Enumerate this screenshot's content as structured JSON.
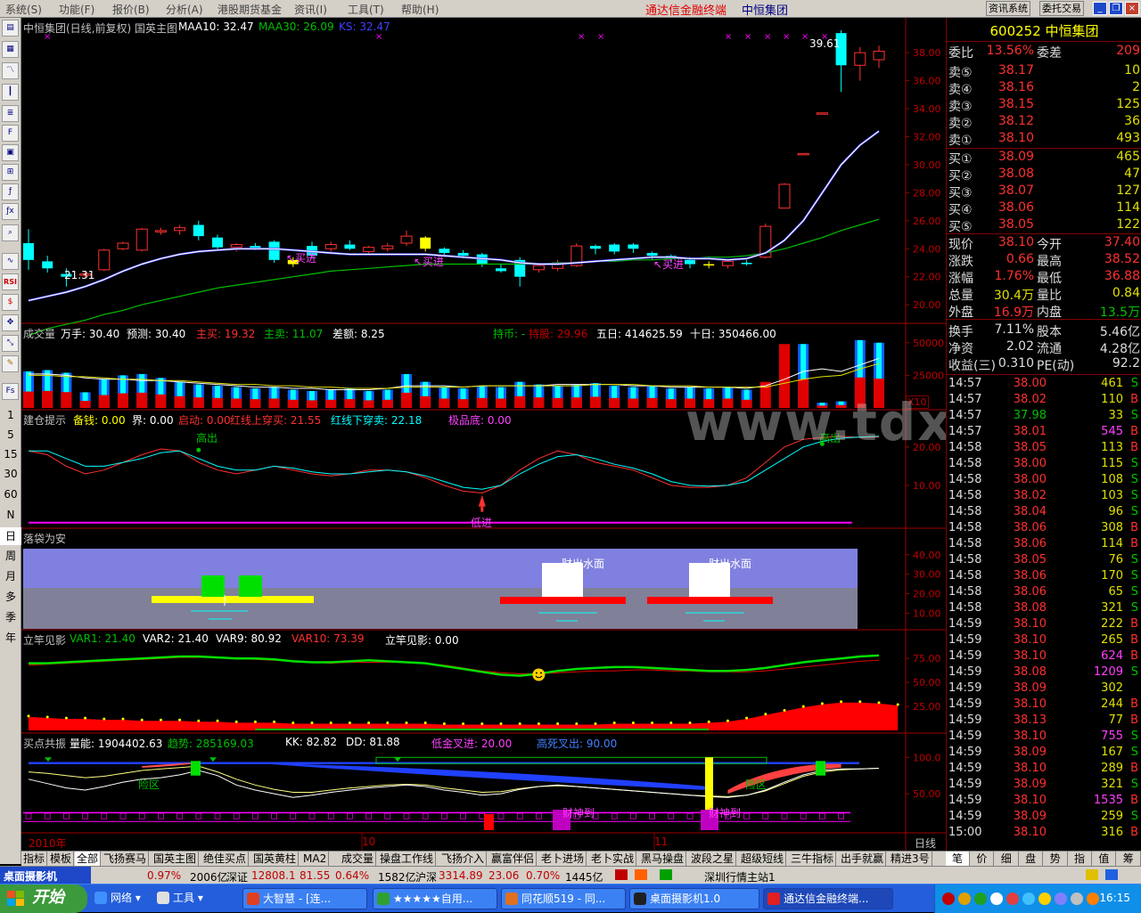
{
  "menu": {
    "items": [
      "系统(S)",
      "功能(F)",
      "报价(B)",
      "分析(A)",
      "港股期货基金",
      "资讯(I)",
      "工具(T)",
      "帮助(H)"
    ],
    "brand": "通达信金融终端",
    "stock_title": "中恒集团",
    "btn_news": "资讯系统",
    "btn_trade": "委托交易"
  },
  "left_tools": [
    "RSI",
    "$",
    "Fs"
  ],
  "periods": [
    "1",
    "5",
    "15",
    "30",
    "60",
    "N",
    "日",
    "周",
    "月",
    "多",
    "季",
    "年"
  ],
  "chart": {
    "main": {
      "header": "中恒集团(日线,前复权) 国英主图",
      "ma10": "MAA10: 32.47",
      "ma30": "MAA30: 26.09",
      "ks": "KS: 32.47",
      "high_label": "39.61",
      "low_label": "21.31",
      "buy_labels": [
        "↖买进",
        "↖买进",
        "↖买进"
      ],
      "yticks": [
        "38.00",
        "36.00",
        "34.00",
        "32.00",
        "30.00",
        "28.00",
        "26.00",
        "24.00",
        "22.00",
        "20.00"
      ]
    },
    "volume": {
      "title": "成交量",
      "wanshou": "万手: 30.40",
      "yuce": "预测: 30.40",
      "zhumai": "主买: 19.32",
      "zhumai2": "主卖: 11.07",
      "chae": "差额: 8.25",
      "chibi": "持币: -",
      "chigu": "持股: 29.96",
      "wuri": "五日: 414625.59",
      "shiri": "十日: 350466.00",
      "yticks": [
        "50000",
        "25000"
      ],
      "unit": "X10"
    },
    "jiancang": {
      "title": "建仓提示",
      "beiqian": "备钱: 0.00",
      "jie": "界: 0.00",
      "qidong": "启动: 0.00",
      "hongshang": "红线上穿买: 21.55",
      "hongxia": "红线下穿卖: 22.18",
      "jipindi": "极品底: 0.00",
      "gaochu": "高出",
      "dijin": "低进",
      "yticks": [
        "20.00",
        "10.00"
      ]
    },
    "luodai": {
      "title": "落袋为安",
      "caichu": "财出水面",
      "yticks": [
        "40.00",
        "30.00",
        "20.00",
        "10.00"
      ]
    },
    "ligan": {
      "title": "立竿见影",
      "var1": "VAR1: 21.40",
      "var2": "VAR2: 21.40",
      "var9": "VAR9: 80.92",
      "var10": "VAR10: 73.39",
      "lgjy": "立竿见影: 0.00",
      "yticks": [
        "75.00",
        "50.00",
        "25.00"
      ]
    },
    "maidian": {
      "title": "买点共振",
      "liangneng": "量能: 1904402.63",
      "qushi": "趋势: 285169.03",
      "kk": "KK: 82.82",
      "dd": "DD: 81.88",
      "dijin": "低金叉进: 20.00",
      "gaosi": "高死叉出: 90.00",
      "xianqu": "险区",
      "caishen": "财神到",
      "yticks": [
        "100.0",
        "50.00"
      ]
    },
    "xaxis": {
      "year": "2010年",
      "m10": "10",
      "m11": "11",
      "period": "日线"
    },
    "watermark": "www.tdxzb.com"
  },
  "quote": {
    "code_name": "600252 中恒集团",
    "weibi_label": "委比",
    "weibi": "13.56%",
    "weicha_label": "委差",
    "weicha": "209",
    "asks": [
      {
        "label": "卖⑤",
        "price": "38.17",
        "vol": "10"
      },
      {
        "label": "卖④",
        "price": "38.16",
        "vol": "2"
      },
      {
        "label": "卖③",
        "price": "38.15",
        "vol": "125"
      },
      {
        "label": "卖②",
        "price": "38.12",
        "vol": "36"
      },
      {
        "label": "卖①",
        "price": "38.10",
        "vol": "493"
      }
    ],
    "bids": [
      {
        "label": "买①",
        "price": "38.09",
        "vol": "465"
      },
      {
        "label": "买②",
        "price": "38.08",
        "vol": "47"
      },
      {
        "label": "买③",
        "price": "38.07",
        "vol": "127"
      },
      {
        "label": "买④",
        "price": "38.06",
        "vol": "114"
      },
      {
        "label": "买⑤",
        "price": "38.05",
        "vol": "122"
      }
    ],
    "stats": [
      {
        "l1": "现价",
        "v1": "38.10",
        "l2": "今开",
        "v2": "37.40"
      },
      {
        "l1": "涨跌",
        "v1": "0.66",
        "l2": "最高",
        "v2": "38.52"
      },
      {
        "l1": "涨幅",
        "v1": "1.76%",
        "l2": "最低",
        "v2": "36.88"
      },
      {
        "l1": "总量",
        "v1": "30.4万",
        "l2": "量比",
        "v2": "0.84"
      },
      {
        "l1": "外盘",
        "v1": "16.9万",
        "l2": "内盘",
        "v2": "13.5万"
      }
    ],
    "stats2": [
      {
        "l1": "换手",
        "v1": "7.11%",
        "l2": "股本",
        "v2": "5.46亿"
      },
      {
        "l1": "净资",
        "v1": "2.02",
        "l2": "流通",
        "v2": "4.28亿"
      },
      {
        "l1": "收益(三)",
        "v1": "0.310",
        "l2": "PE(动)",
        "v2": "92.2"
      }
    ],
    "ticks": [
      {
        "t": "14:57",
        "p": "38.00",
        "v": "461",
        "s": "S"
      },
      {
        "t": "14:57",
        "p": "38.02",
        "v": "110",
        "s": "B"
      },
      {
        "t": "14:57",
        "p": "37.98",
        "v": "33",
        "s": "S"
      },
      {
        "t": "14:57",
        "p": "38.01",
        "v": "545",
        "s": "B"
      },
      {
        "t": "14:58",
        "p": "38.05",
        "v": "113",
        "s": "B"
      },
      {
        "t": "14:58",
        "p": "38.00",
        "v": "115",
        "s": "S"
      },
      {
        "t": "14:58",
        "p": "38.00",
        "v": "108",
        "s": "S"
      },
      {
        "t": "14:58",
        "p": "38.02",
        "v": "103",
        "s": "S"
      },
      {
        "t": "14:58",
        "p": "38.04",
        "v": "96",
        "s": "S"
      },
      {
        "t": "14:58",
        "p": "38.06",
        "v": "308",
        "s": "B"
      },
      {
        "t": "14:58",
        "p": "38.06",
        "v": "114",
        "s": "B"
      },
      {
        "t": "14:58",
        "p": "38.05",
        "v": "76",
        "s": "S"
      },
      {
        "t": "14:58",
        "p": "38.06",
        "v": "170",
        "s": "S"
      },
      {
        "t": "14:58",
        "p": "38.06",
        "v": "65",
        "s": "S"
      },
      {
        "t": "14:58",
        "p": "38.08",
        "v": "321",
        "s": "S"
      },
      {
        "t": "14:59",
        "p": "38.10",
        "v": "222",
        "s": "B"
      },
      {
        "t": "14:59",
        "p": "38.10",
        "v": "265",
        "s": "B"
      },
      {
        "t": "14:59",
        "p": "38.10",
        "v": "624",
        "s": "B"
      },
      {
        "t": "14:59",
        "p": "38.08",
        "v": "1209",
        "s": "S"
      },
      {
        "t": "14:59",
        "p": "38.09",
        "v": "302",
        "s": ""
      },
      {
        "t": "14:59",
        "p": "38.10",
        "v": "244",
        "s": "B"
      },
      {
        "t": "14:59",
        "p": "38.13",
        "v": "77",
        "s": "B"
      },
      {
        "t": "14:59",
        "p": "38.10",
        "v": "755",
        "s": "S"
      },
      {
        "t": "14:59",
        "p": "38.09",
        "v": "167",
        "s": "S"
      },
      {
        "t": "14:59",
        "p": "38.10",
        "v": "289",
        "s": "B"
      },
      {
        "t": "14:59",
        "p": "38.09",
        "v": "321",
        "s": "S"
      },
      {
        "t": "14:59",
        "p": "38.10",
        "v": "1535",
        "s": "B"
      },
      {
        "t": "14:59",
        "p": "38.09",
        "v": "259",
        "s": "S"
      },
      {
        "t": "15:00",
        "p": "38.10",
        "v": "316",
        "s": "B"
      }
    ]
  },
  "tabs": [
    "指标",
    "模板",
    "全部",
    "飞扬赛马",
    "国英主图",
    "绝佳买点",
    "国英黄柱",
    "MA2",
    "成交量",
    "操盘工作线",
    "飞扬介入",
    "赢富伴侣",
    "老卜进场",
    "老卜实战",
    "黑马操盘",
    "波段之星",
    "超级短线",
    "三牛指标",
    "出手就赢",
    "精进3号"
  ],
  "rtabs": [
    "笔",
    "价",
    "细",
    "盘",
    "势",
    "指",
    "值",
    "筹"
  ],
  "status": {
    "label": "桌面摄影机",
    "sh_pct": "0.97%",
    "sh_amt": "2006亿",
    "sz_label": "深证",
    "sz_val": "12808.1",
    "sz_chg": "81.55",
    "sz_pct": "0.64%",
    "sz_amt": "1582亿",
    "hs_label": "沪深",
    "hs_val": "3314.89",
    "hs_chg": "23.06",
    "hs_pct": "0.70%",
    "hs_amt": "1445亿",
    "server": "深圳行情主站1"
  },
  "taskbar": {
    "start": "开始",
    "items": [
      "网络",
      "工具",
      "大智慧 - [连...",
      "★★★★★自用...",
      "同花顺519 - 同...",
      "桌面摄影机1.0",
      "通达信金融终端..."
    ],
    "clock": "16:15"
  },
  "colors": {
    "up": "#ff3030",
    "down": "#00ffff",
    "ma10": "#ffffff",
    "ma30": "#00c000",
    "ks": "#4040ff",
    "yellow": "#ffff00",
    "magenta": "#ff00ff",
    "grid": "#800000",
    "text": "#c0c0c0"
  }
}
